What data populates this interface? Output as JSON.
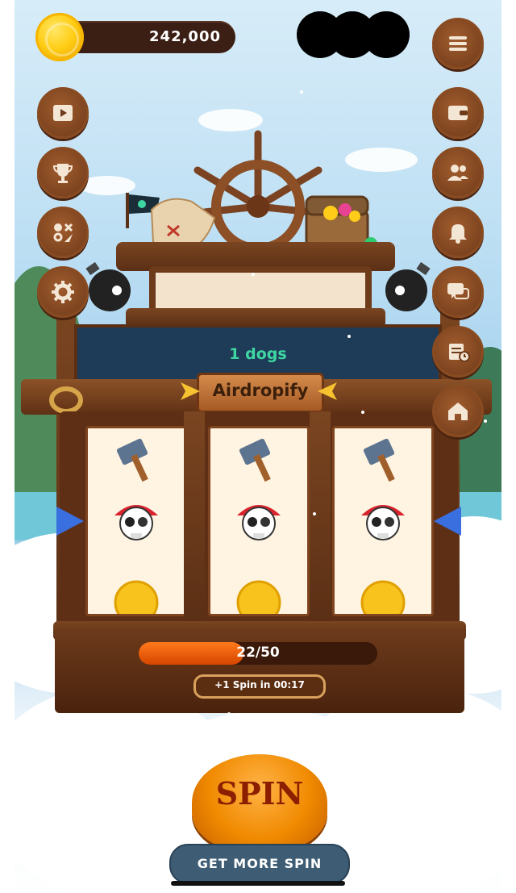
{
  "hud": {
    "coin_balance": "242,000",
    "coin_icon": "gold-coin-icon"
  },
  "left_menu": [
    {
      "name": "video-button",
      "icon": "play-video-icon"
    },
    {
      "name": "trophy-button",
      "icon": "trophy-icon"
    },
    {
      "name": "minigames-button",
      "icon": "games-icon"
    },
    {
      "name": "settings-button",
      "icon": "gear-icon"
    }
  ],
  "right_menu": [
    {
      "name": "menu-button",
      "icon": "hamburger-icon"
    },
    {
      "name": "wallet-button",
      "icon": "wallet-icon"
    },
    {
      "name": "friends-button",
      "icon": "users-icon"
    },
    {
      "name": "notifications-button",
      "icon": "bell-icon"
    },
    {
      "name": "chat-button",
      "icon": "chat-icon"
    },
    {
      "name": "tasks-button",
      "icon": "calendar-clock-icon"
    },
    {
      "name": "home-button",
      "icon": "house-icon"
    }
  ],
  "machine": {
    "reward_text": "1 dogs",
    "title": "Airdropify",
    "reels": [
      [
        "hammer",
        "pirate-skull",
        "gold-coin"
      ],
      [
        "hammer",
        "pirate-skull",
        "gold-coin"
      ],
      [
        "hammer",
        "pirate-skull",
        "gold-coin"
      ]
    ]
  },
  "spins": {
    "current": 22,
    "max": 50,
    "label": "22/50",
    "fill_fraction": 0.44,
    "timer_text": "+1 Spin in 00:17"
  },
  "actions": {
    "spin_label": "SPIN",
    "get_more_label": "GET MORE SPIN"
  },
  "colors": {
    "wood": "#6d3a1a",
    "accent_green": "#3ed7a3",
    "spin_orange": "#f08a00",
    "bar_orange": "#ff7a1c"
  }
}
